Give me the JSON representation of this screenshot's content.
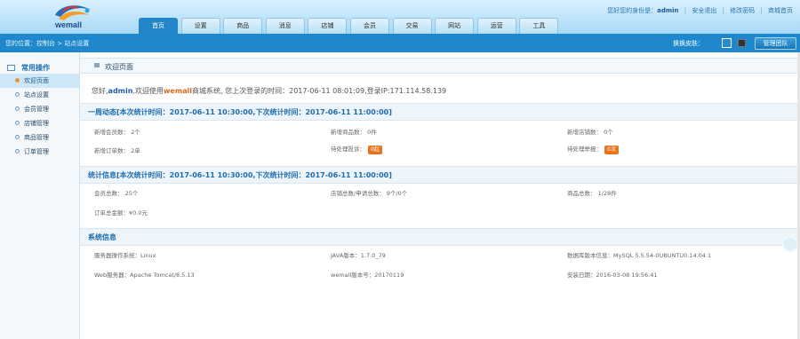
{
  "header": {
    "logo_text": "wemall",
    "user_links": {
      "greeting": "您好您的身份是：",
      "username": "admin",
      "logout": "安全退出",
      "change_password": "修改密码",
      "site_home": "商城首页"
    },
    "tabs": [
      {
        "label": "首页",
        "active": true
      },
      {
        "label": "设置",
        "active": false
      },
      {
        "label": "商品",
        "active": false
      },
      {
        "label": "消息",
        "active": false
      },
      {
        "label": "店铺",
        "active": false
      },
      {
        "label": "会员",
        "active": false
      },
      {
        "label": "交易",
        "active": false
      },
      {
        "label": "网站",
        "active": false
      },
      {
        "label": "运营",
        "active": false
      },
      {
        "label": "工具",
        "active": false
      }
    ]
  },
  "subbar": {
    "breadcrumb": "您的位置：控制台 > 站点设置",
    "skin_label": "换换皮肤：",
    "admin_button": "管理团队",
    "skin_colors": {
      "blue": "#2a8ad0",
      "dark": "#333333"
    }
  },
  "sidebar": {
    "title": "常用操作",
    "items": [
      {
        "label": "欢迎页面",
        "active": true
      },
      {
        "label": "站点设置",
        "active": false
      },
      {
        "label": "会员管理",
        "active": false
      },
      {
        "label": "店铺管理",
        "active": false
      },
      {
        "label": "商品管理",
        "active": false
      },
      {
        "label": "订单管理",
        "active": false
      }
    ]
  },
  "main": {
    "tab_title": "欢迎页面",
    "welcome": {
      "prefix": "您好,",
      "username": "admin",
      "middle": ",欢迎使用",
      "brand": "wemall",
      "suffix": "商城系统, 您上次登录的时间：2017-06-11 08:01:09,登录IP:171.114.58.139"
    },
    "weekly": {
      "title": "一周动态[本次统计时间：2017-06-11 10:30:00,下次统计时间：2017-06-11 11:00:00]",
      "cells": {
        "new_members": "新增会员数：  2个",
        "new_products": "新增商品数：  0件",
        "new_shops": "新增店铺数：  0个",
        "new_orders": "新增订单数：  2单",
        "pending_shop_label": "待处理投诉：",
        "pending_shop_badge": "0起",
        "pending_report_label": "待处理举报：",
        "pending_report_badge": "0次"
      }
    },
    "stats": {
      "title": "统计信息[本次统计时间：2017-06-11 10:30:00,下次统计时间：2017-06-11 11:00:00]",
      "cells": {
        "members_total": "会员总数：  25个",
        "shops_total": "店铺总数/申请总数：  9个/0个",
        "products_total": "商品总数：  1/28件",
        "orders_amount": "订单总金额：¥0.0元"
      }
    },
    "system": {
      "title": "系统信息",
      "cells": {
        "os": "服务器操作系统：Linux",
        "java": "JAVA版本：1.7.0_79",
        "db": "数据库版本信息：MySQL 5.5.54-0UBUNTU0.14.04.1",
        "web_server": "Web服务器：Apache Tomcat/8.5.13",
        "wemall_version": "wemall版本号：20170119",
        "install_date": "安装日期：2016-03-08 19:56:41"
      }
    }
  }
}
